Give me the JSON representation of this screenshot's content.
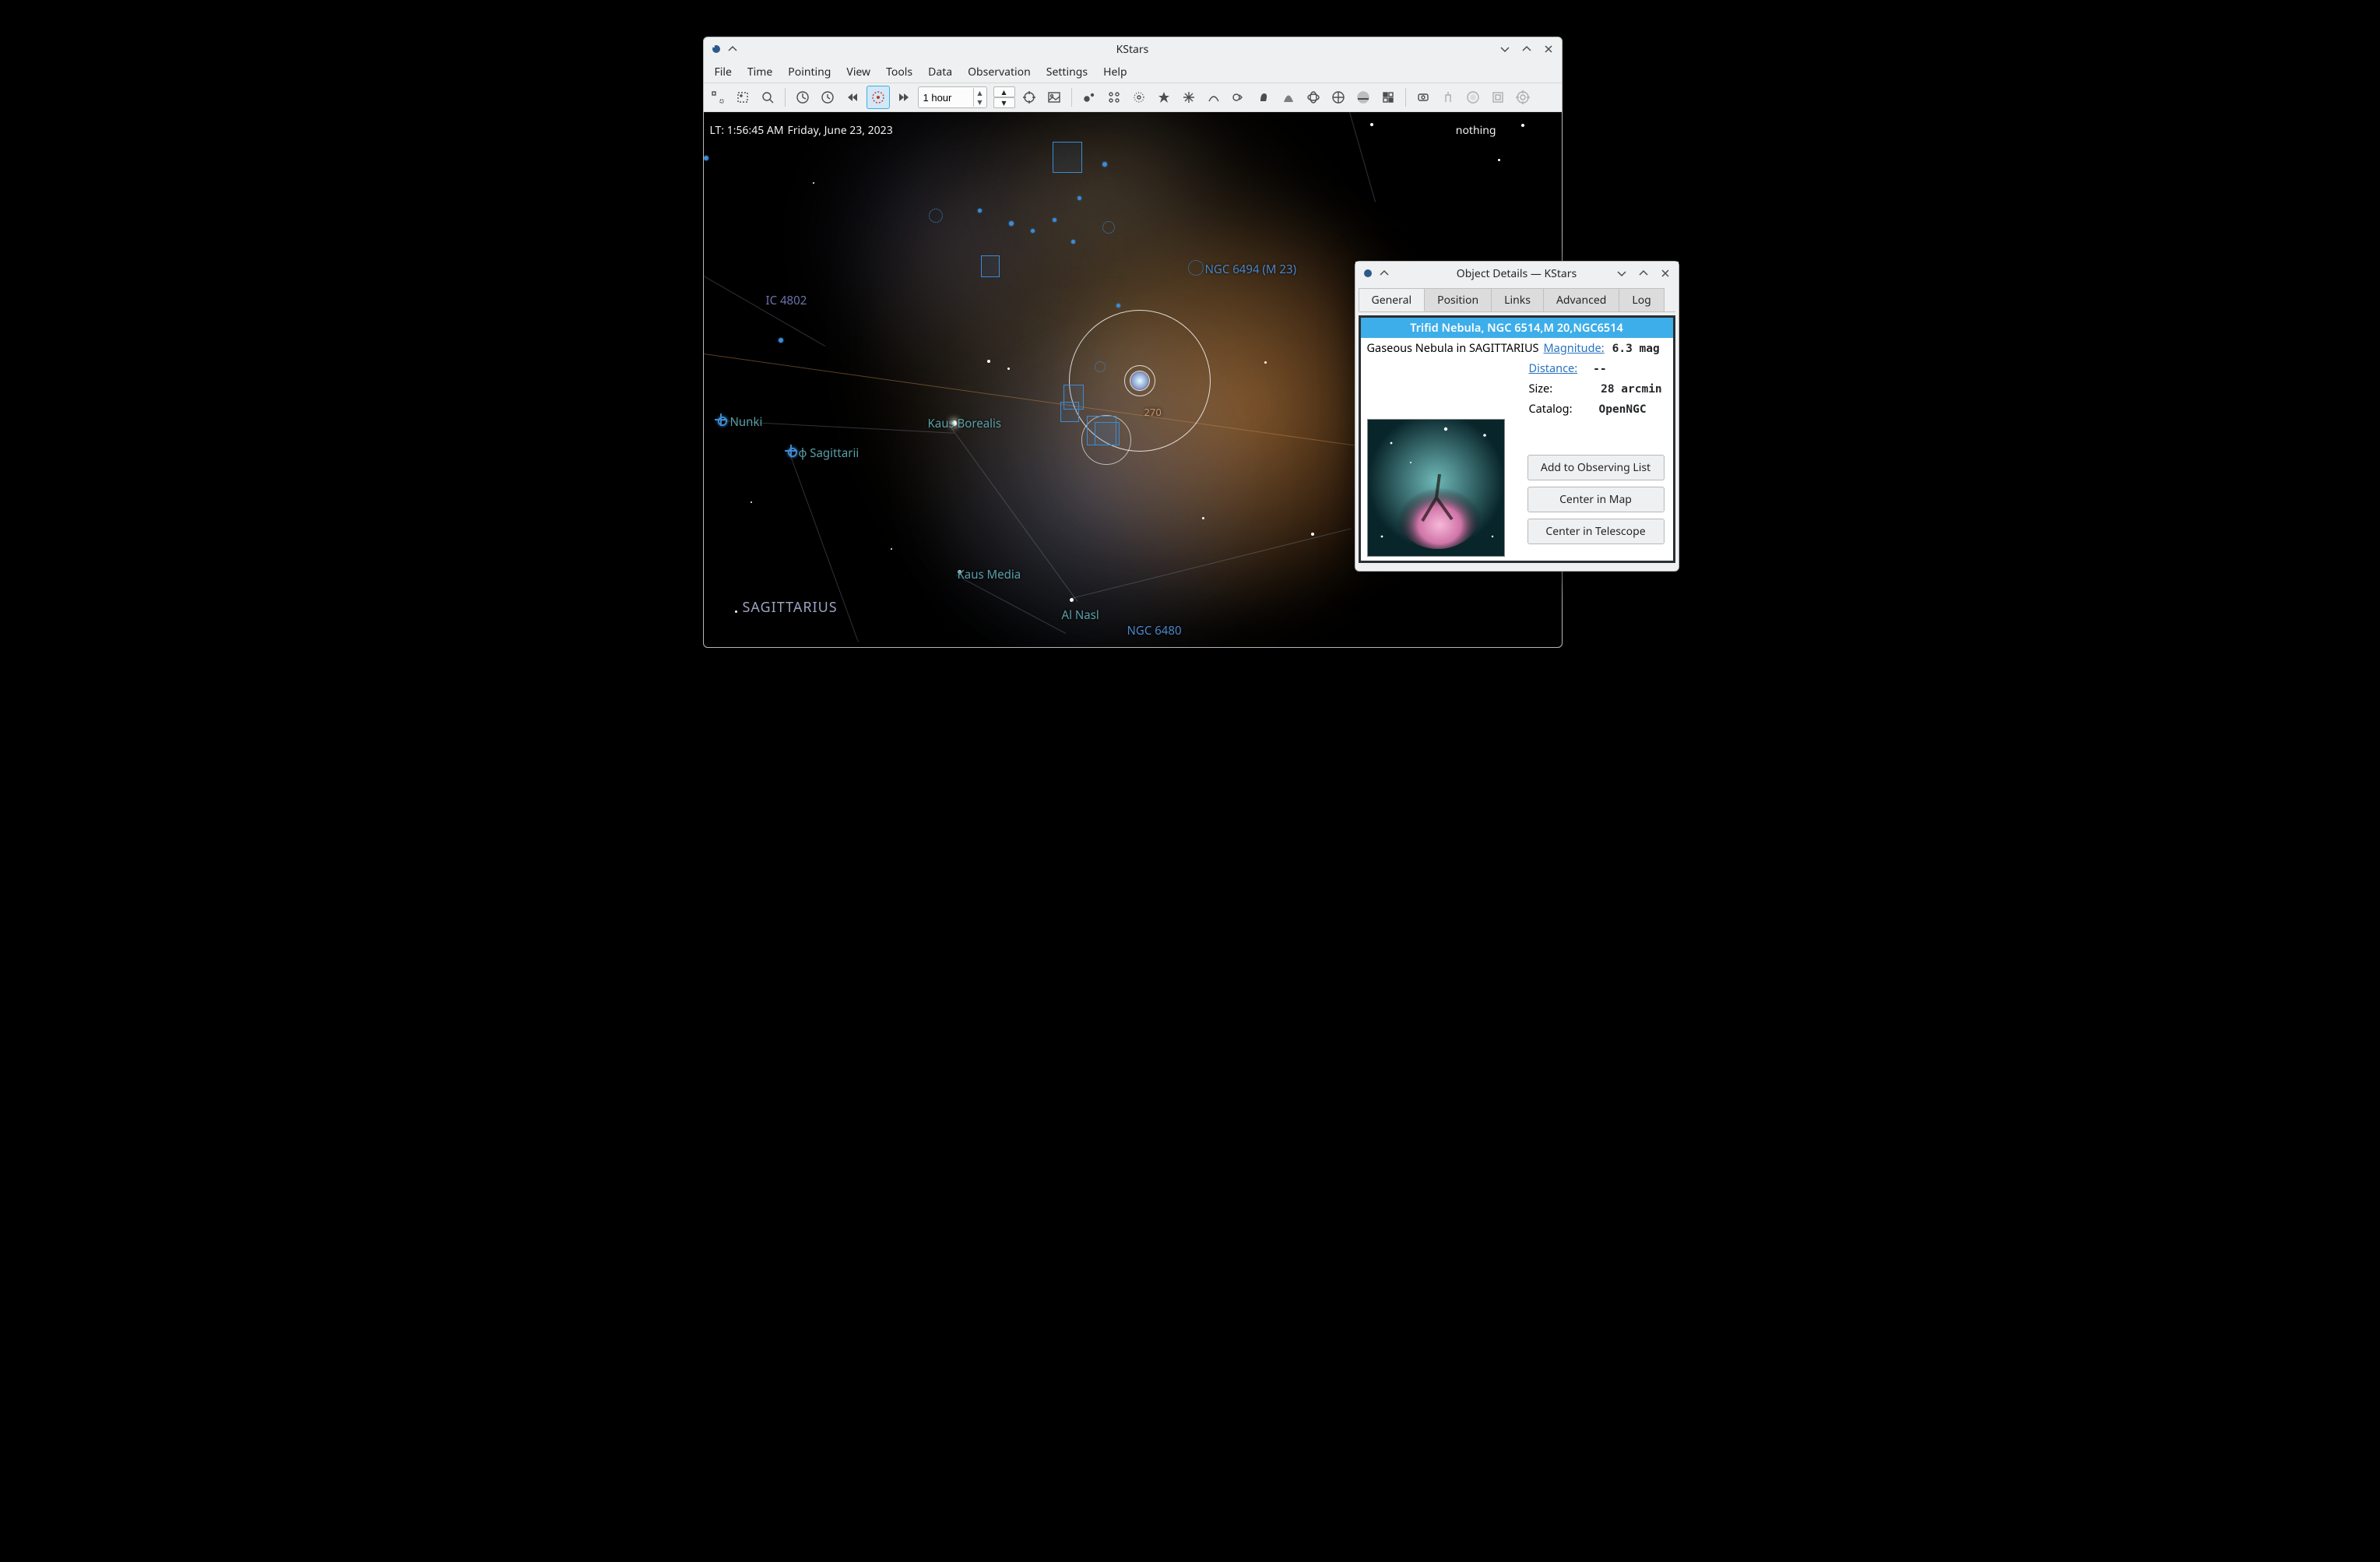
{
  "main": {
    "title": "KStars",
    "menus": [
      "File",
      "Time",
      "Pointing",
      "View",
      "Tools",
      "Data",
      "Observation",
      "Settings",
      "Help"
    ],
    "timestep": "1 hour",
    "lt": "LT: 1:56:45 AM",
    "date": "Friday, June 23, 2023",
    "cursor_obj": "nothing"
  },
  "skylabels": {
    "ic4802": "IC 4802",
    "ngc6494": "NGC 6494 (M 23)",
    "nunki": "Nunki",
    "phisgr": "φ Sagittarii",
    "kausbor": "Kaus Borealis",
    "kausmed": "Kaus Media",
    "alnasl": "Al Nasl",
    "ngc6480": "NGC 6480",
    "sgr": "SAGITTARIUS",
    "ecl270": "270"
  },
  "details": {
    "title": "Object Details — KStars",
    "tabs": [
      "General",
      "Position",
      "Links",
      "Advanced",
      "Log"
    ],
    "active_tab": 0,
    "name": "Trifid Nebula, NGC 6514,M 20,NGC6514",
    "typeline": "Gaseous Nebula in SAGITTARIUS",
    "mag_label": "Magnitude:",
    "mag_value": "6.3 mag",
    "dist_label": "Distance:",
    "dist_value": "--",
    "size_label": "Size:",
    "size_value": "28 arcmin",
    "cat_label": "Catalog:",
    "cat_value": "OpenNGC",
    "buttons": [
      "Add to Observing List",
      "Center in Map",
      "Center in Telescope"
    ]
  }
}
